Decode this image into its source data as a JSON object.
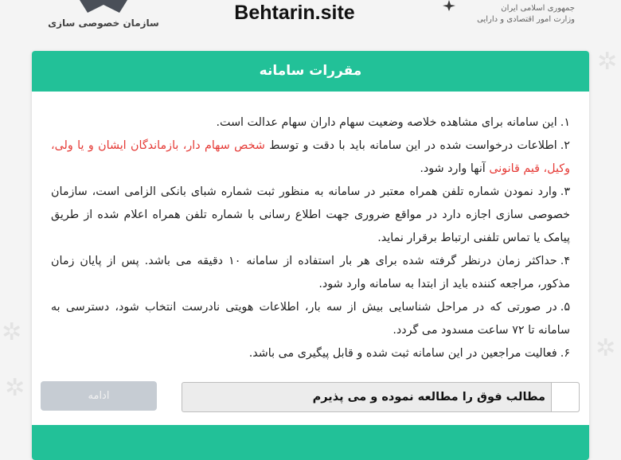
{
  "header": {
    "left_logo_text": "سازمان خصوصی سازی",
    "site_title": "Behtarin.site",
    "right_logo_line1": "جمهوری اسلامی ایران",
    "right_logo_line2": "وزارت امور اقتصادی و دارایی"
  },
  "card": {
    "title": "مقررات سامانه",
    "rules": [
      {
        "num": "۱.",
        "parts": [
          {
            "text": "این سامانه برای مشاهده خلاصه وضعیت سهام داران سهام عدالت است.",
            "red": false
          }
        ]
      },
      {
        "num": "۲.",
        "parts": [
          {
            "text": "اطلاعات درخواست شده در این سامانه باید با دقت و توسط ",
            "red": false
          },
          {
            "text": "شخص سهام دار، بازماندگان ایشان و یا ولی، وکیل، قیم قانونی",
            "red": true
          },
          {
            "text": " آنها وارد شود.",
            "red": false
          }
        ]
      },
      {
        "num": "۳.",
        "parts": [
          {
            "text": "وارد نمودن شماره تلفن همراه معتبر در سامانه به منظور ثبت شماره شبای بانکی الزامی است، سازمان خصوصی سازی اجازه دارد در مواقع ضروری جهت اطلاع رسانی با شماره تلفن همراه اعلام شده از طریق پیامک یا تماس تلفنی ارتباط برقرار نماید.",
            "red": false
          }
        ]
      },
      {
        "num": "۴.",
        "parts": [
          {
            "text": "حداکثر زمان درنظر گرفته شده برای هر بار استفاده از سامانه ۱۰ دقیقه می باشد. پس از پایان زمان مذکور، مراجعه کننده باید از ابتدا به سامانه وارد شود.",
            "red": false
          }
        ]
      },
      {
        "num": "۵.",
        "parts": [
          {
            "text": "در صورتی که در مراحل شناسایی بیش از سه بار، اطلاعات هویتی نادرست انتخاب شود، دسترسی به سامانه تا ۷۲ ساعت مسدود می گردد.",
            "red": false
          }
        ]
      },
      {
        "num": "۶.",
        "parts": [
          {
            "text": "فعالیت مراجعین در این سامانه ثبت شده و قابل پیگیری می باشد.",
            "red": false
          }
        ]
      }
    ],
    "accept_label": "مطالب فوق را مطالعه نموده و می پذیرم",
    "accept_checked": false,
    "continue_label": "ادامه",
    "continue_enabled": false
  },
  "colors": {
    "accent": "#22c198",
    "rule_highlight": "#e53935",
    "disabled_button": "#c6ccd3"
  },
  "icons": {
    "left_logo": "privatization-org-logo",
    "right_logo": "iran-emblem"
  }
}
